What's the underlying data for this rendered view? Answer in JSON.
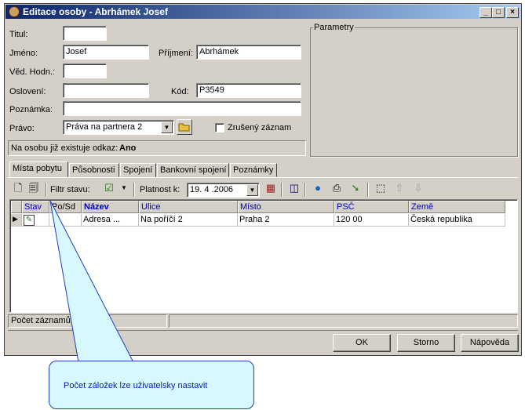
{
  "window": {
    "title": "Editace osoby - Abrhámek Josef",
    "min_symbol": "_",
    "max_symbol": "□",
    "close_symbol": "×"
  },
  "form": {
    "titul_label": "Titul:",
    "titul_value": "",
    "jmeno_label": "Jméno:",
    "jmeno_value": "Josef",
    "prijmeni_label": "Příjmení:",
    "prijmeni_value": "Abrhámek",
    "ved_hodn_label": "Věd. Hodn.:",
    "ved_hodn_value": "",
    "osloveni_label": "Oslovení:",
    "osloveni_value": "",
    "kod_label": "Kód:",
    "kod_value": "P3549",
    "poznamka_label": "Poznámka:",
    "poznamka_value": "",
    "pravo_label": "Právo:",
    "pravo_value": "Práva na partnera 2",
    "zruseny_label": "Zrušený záznam",
    "zruseny_checked": false,
    "odkaz_text": "Na osobu již existuje odkaz:",
    "odkaz_value": "Ano"
  },
  "parametry": {
    "label": "Parametry"
  },
  "tabs": [
    {
      "label": "Místa pobytu",
      "active": true
    },
    {
      "label": "Působnosti",
      "active": false
    },
    {
      "label": "Spojení",
      "active": false
    },
    {
      "label": "Bankovní spojení",
      "active": false
    },
    {
      "label": "Poznámky",
      "active": false
    }
  ],
  "toolbar": {
    "filtr_label": "Filtr stavu:",
    "platnost_label": "Platnost k:",
    "platnost_value": "19. 4 .2006"
  },
  "grid": {
    "columns": [
      "Stav",
      "Po/Sd",
      "Název",
      "Ulice",
      "Místo",
      "PSČ",
      "Země"
    ],
    "rows": [
      {
        "stav": "",
        "posd": "",
        "nazev": "Adresa ...",
        "ulice": "Na poříčí 2",
        "misto": "Praha 2",
        "psc": "120 00",
        "zeme": "Česká republika"
      }
    ]
  },
  "status": {
    "count_label": "Počet záznamů: 1"
  },
  "buttons": {
    "ok": "OK",
    "storno": "Storno",
    "napoveda": "Nápověda"
  },
  "callout": {
    "text": "Počet záložek lze uživatelsky nastavit"
  }
}
